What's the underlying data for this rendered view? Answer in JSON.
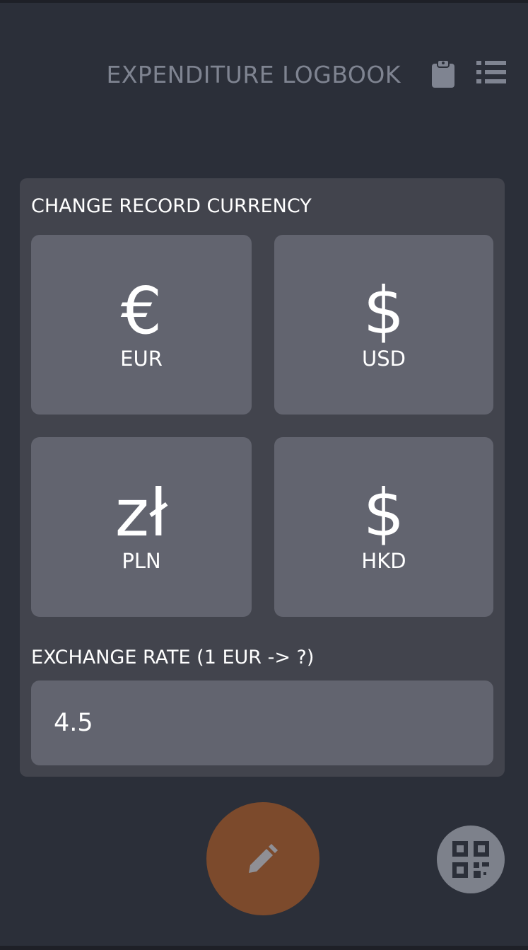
{
  "header": {
    "title": "EXPENDITURE LOGBOOK",
    "icons": [
      "clipboard-icon",
      "list-icon"
    ]
  },
  "currency_section": {
    "title": "CHANGE RECORD CURRENCY",
    "options": [
      {
        "symbol": "€",
        "code": "EUR"
      },
      {
        "symbol": "$",
        "code": "USD"
      },
      {
        "symbol": "zł",
        "code": "PLN"
      },
      {
        "symbol": "$",
        "code": "HKD"
      }
    ]
  },
  "exchange": {
    "label": "EXCHANGE RATE (1 EUR -> ?)",
    "value": "4.5"
  },
  "actions": {
    "edit_icon": "pencil-icon",
    "qr_icon": "qr-code-icon"
  },
  "colors": {
    "background": "#2b2f39",
    "card": "#42444d",
    "tile": "#62646f",
    "accent": "#7c4a2c",
    "muted": "#7f8491"
  }
}
